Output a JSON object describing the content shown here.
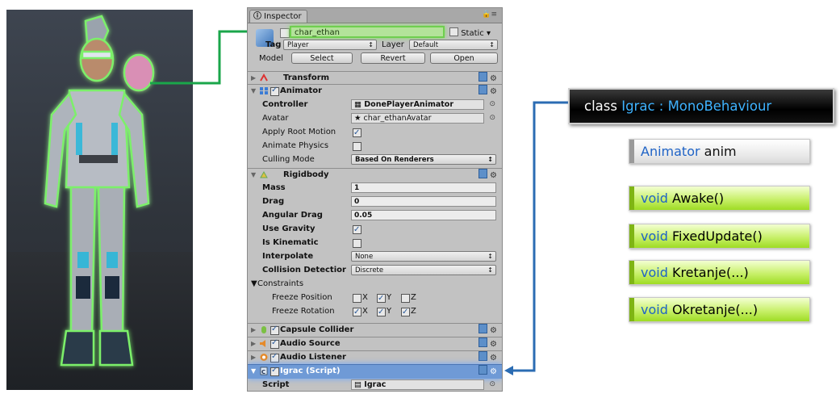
{
  "inspector": {
    "tab_label": "Inspector",
    "header": {
      "object_name": "char_ethan",
      "static_label": "Static",
      "tag_label": "Tag",
      "tag_value": "Player",
      "layer_label": "Layer",
      "layer_value": "Default",
      "model_label": "Model",
      "model_buttons": [
        "Select",
        "Revert",
        "Open"
      ]
    },
    "transform": {
      "title": "Transform"
    },
    "animator": {
      "title": "Animator",
      "rows": [
        {
          "label": "Controller",
          "value": "DonePlayerAnimator"
        },
        {
          "label": "Avatar",
          "value": "char_ethanAvatar"
        },
        {
          "label": "Apply Root Motion",
          "checked": true
        },
        {
          "label": "Animate Physics",
          "checked": false
        },
        {
          "label": "Culling Mode",
          "value": "Based On Renderers"
        }
      ]
    },
    "rigidbody": {
      "title": "Rigidbody",
      "mass_label": "Mass",
      "mass": "1",
      "drag_label": "Drag",
      "drag": "0",
      "angular_drag_label": "Angular Drag",
      "angular_drag": "0.05",
      "use_gravity_label": "Use Gravity",
      "use_gravity": true,
      "is_kinematic_label": "Is Kinematic",
      "is_kinematic": false,
      "interpolate_label": "Interpolate",
      "interpolate": "None",
      "collision_label": "Collision Detectior",
      "collision": "Discrete",
      "constraints_label": "Constraints",
      "freeze_position_label": "Freeze Position",
      "freeze_rotation_label": "Freeze Rotation",
      "axis_x": "X",
      "axis_y": "Y",
      "axis_z": "Z",
      "freeze_position": [
        false,
        true,
        false
      ],
      "freeze_rotation": [
        true,
        true,
        true
      ]
    },
    "components": [
      {
        "title": "Capsule Collider"
      },
      {
        "title": "Audio Source"
      },
      {
        "title": "Audio Listener"
      }
    ],
    "script_component": {
      "title": "Igrac (Script)",
      "script_label": "Script",
      "script_value": "Igrac"
    }
  },
  "diagram": {
    "class_keyword": "class",
    "class_name": "Igrac : MonoBehaviour",
    "field": {
      "type": "Animator",
      "name": "anim"
    },
    "methods": [
      {
        "ret": "void",
        "name": "Awake()"
      },
      {
        "ret": "void",
        "name": "FixedUpdate()"
      },
      {
        "ret": "void",
        "name": "Kretanje(...)"
      },
      {
        "ret": "void",
        "name": "Okretanje(...)"
      }
    ]
  },
  "colors": {
    "name_highlight": "#6fcf4f",
    "selected_component": "#6f9ad6",
    "connector_green": "#1aa64a",
    "connector_blue": "#2b6cb3",
    "class_keyword": "#3fb3ff",
    "method_green": "#9edc24"
  },
  "icons": [
    "info-icon",
    "lock-icon",
    "menu-icon",
    "cube-icon",
    "transform-icon",
    "animator-icon",
    "rigidbody-icon",
    "capsule-collider-icon",
    "audio-source-icon",
    "audio-listener-icon",
    "script-icon",
    "help-book-icon",
    "gear-icon",
    "object-picker-icon"
  ]
}
